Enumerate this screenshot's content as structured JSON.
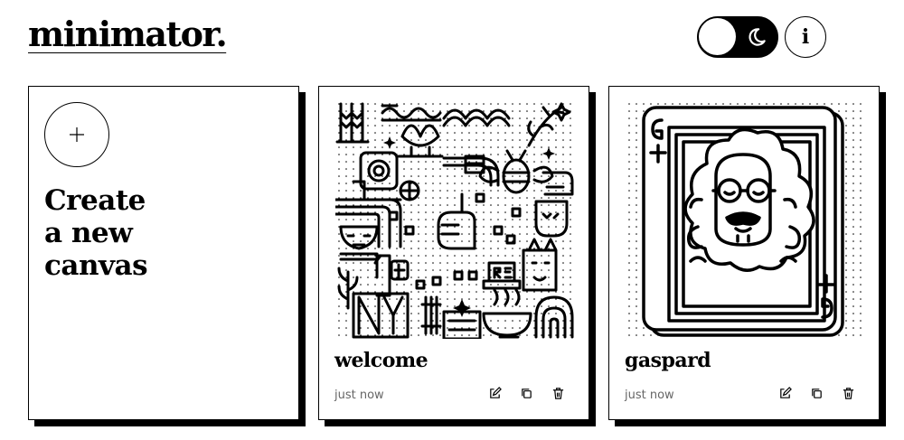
{
  "app": {
    "logo": "minimator."
  },
  "header": {
    "theme_toggle_icon": "moon-icon",
    "info_label": "i"
  },
  "new_canvas": {
    "icon": "plus-icon",
    "lines": [
      "Create",
      "a new",
      "canvas"
    ]
  },
  "canvases": [
    {
      "title": "welcome",
      "time": "just now",
      "art": "welcome-artwork"
    },
    {
      "title": "gaspard",
      "time": "just now",
      "art": "gaspard-card-artwork"
    }
  ],
  "card_actions": [
    "edit-icon",
    "duplicate-icon",
    "delete-icon"
  ]
}
